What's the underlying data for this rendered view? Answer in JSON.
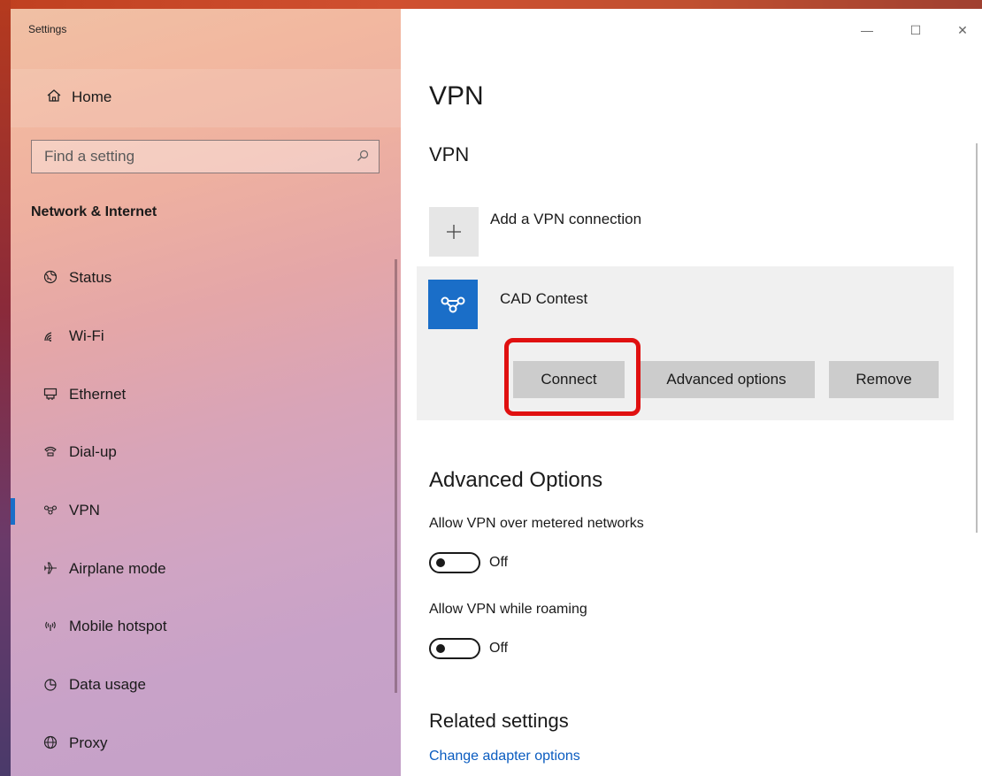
{
  "window": {
    "title": "Settings",
    "controls": {
      "minimize": "—",
      "maximize": "☐",
      "close": "✕"
    }
  },
  "sidebar": {
    "home_label": "Home",
    "search_placeholder": "Find a setting",
    "section_title": "Network & Internet",
    "selected_item": "VPN",
    "items": [
      {
        "label": "Status",
        "icon": "globe-icon"
      },
      {
        "label": "Wi-Fi",
        "icon": "wifi-icon"
      },
      {
        "label": "Ethernet",
        "icon": "ethernet-icon"
      },
      {
        "label": "Dial-up",
        "icon": "dialup-icon"
      },
      {
        "label": "VPN",
        "icon": "vpn-icon"
      },
      {
        "label": "Airplane mode",
        "icon": "airplane-icon"
      },
      {
        "label": "Mobile hotspot",
        "icon": "hotspot-icon"
      },
      {
        "label": "Data usage",
        "icon": "data-usage-icon"
      },
      {
        "label": "Proxy",
        "icon": "proxy-globe-icon"
      }
    ]
  },
  "content": {
    "page_title": "VPN",
    "vpn_section_title": "VPN",
    "add_connection_label": "Add a VPN connection",
    "connection": {
      "name": "CAD Contest",
      "buttons": {
        "connect": "Connect",
        "advanced": "Advanced options",
        "remove": "Remove"
      }
    },
    "advanced_options": {
      "title": "Advanced Options",
      "metered": {
        "caption": "Allow VPN over metered networks",
        "state": "Off"
      },
      "roaming": {
        "caption": "Allow VPN while roaming",
        "state": "Off"
      }
    },
    "related": {
      "title": "Related settings",
      "link": "Change adapter options"
    }
  },
  "colors": {
    "accent": "#1a6ec8",
    "highlight": "#e01010",
    "link": "#0a5cc0"
  }
}
